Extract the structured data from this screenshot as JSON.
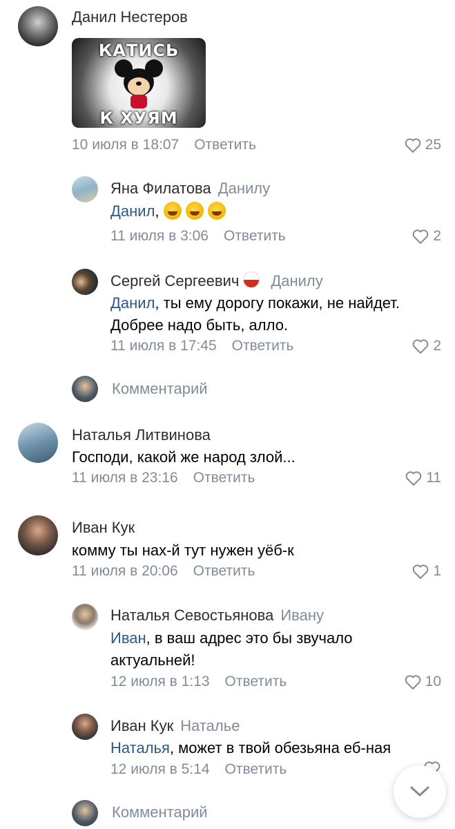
{
  "comments": [
    {
      "author": "Данил Нестеров",
      "image_text_top": "КАТИСЬ",
      "image_text_bottom": "К ХУЯМ",
      "date": "10 июля в 18:07",
      "reply_label": "Ответить",
      "likes": "25"
    },
    {
      "author": "Яна Филатова",
      "reply_to": "Данилу",
      "mention": "Данил",
      "text_after": ",",
      "emoji_count": 3,
      "date": "11 июля в 3:06",
      "reply_label": "Ответить",
      "likes": "2"
    },
    {
      "author": "Сергей Сергеевич",
      "reply_to": "Данилу",
      "mention": "Данил",
      "text_after": ", ты ему дорогу покажи, не найдет.",
      "text_line2": "Добрее надо быть, алло.",
      "date": "11 июля в 17:45",
      "reply_label": "Ответить",
      "likes": "2"
    },
    {
      "author": "Наталья Литвинова",
      "text": "Господи, какой же народ злой...",
      "date": "11 июля в 23:16",
      "reply_label": "Ответить",
      "likes": "11"
    },
    {
      "author": "Иван Кук",
      "text": "комму ты нах-й тут нужен уёб-к",
      "date": "11 июля в 20:06",
      "reply_label": "Ответить",
      "likes": "1"
    },
    {
      "author": "Наталья Севостьянова",
      "reply_to": "Ивану",
      "mention": "Иван",
      "text_after": ", в ваш адрес это бы звучало",
      "text_line2": "актуальней!",
      "date": "12 июля в 1:13",
      "reply_label": "Ответить",
      "likes": "10"
    },
    {
      "author": "Иван Кук",
      "reply_to": "Наталье",
      "mention": "Наталья",
      "text_after": ", может в твой обезьяна еб-ная",
      "date": "12 июля в 5:14",
      "reply_label": "Ответить"
    }
  ],
  "comment_placeholder_1": "Комментарий",
  "comment_placeholder_2": "Комментарий",
  "colors": {
    "link": "#2a5885",
    "meta": "#818c99",
    "text": "#000000"
  }
}
